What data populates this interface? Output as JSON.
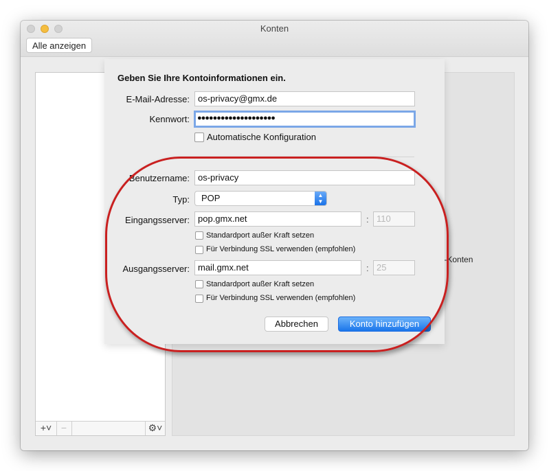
{
  "window": {
    "title": "Konten"
  },
  "toolbar": {
    "show_all_label": "Alle anzeigen"
  },
  "account_list": {
    "add_glyph": "+˅",
    "remove_glyph": "−",
    "settings_glyph": "⚙˅"
  },
  "detail": {
    "partial_text": "soft-Konten"
  },
  "sheet": {
    "heading": "Geben Sie Ihre Kontoinformationen ein.",
    "email": {
      "label": "E-Mail-Adresse:",
      "value": "os-privacy@gmx.de"
    },
    "password": {
      "label": "Kennwort:",
      "value": "●●●●●●●●●●●●●●●●●●●●"
    },
    "auto_config": {
      "label": "Automatische Konfiguration",
      "checked": false
    },
    "username": {
      "label": "Benutzername:",
      "value": "os-privacy"
    },
    "type": {
      "label": "Typ:",
      "value": "POP"
    },
    "incoming": {
      "label": "Eingangsserver:",
      "value": "pop.gmx.net",
      "port_separator": ":",
      "port_placeholder": "110",
      "override_port_label": "Standardport außer Kraft setzen",
      "ssl_label": "Für Verbindung SSL verwenden (empfohlen)"
    },
    "outgoing": {
      "label": "Ausgangsserver:",
      "value": "mail.gmx.net",
      "port_separator": ":",
      "port_placeholder": "25",
      "override_port_label": "Standardport außer Kraft setzen",
      "ssl_label": "Für Verbindung SSL verwenden (empfohlen)"
    },
    "cancel_label": "Abbrechen",
    "add_account_label": "Konto hinzufügen"
  },
  "colors": {
    "accent": "#1b75ea",
    "highlight_oval": "#c92020",
    "focus_ring": "#7ba7e7"
  }
}
